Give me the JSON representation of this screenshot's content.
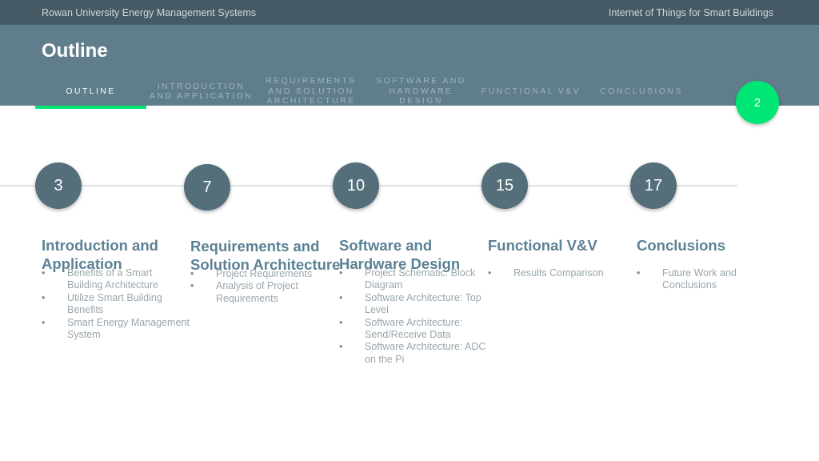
{
  "topbar": {
    "left_text": "Rowan University Energy Management Systems",
    "right_text": "Internet of Things for Smart Buildings"
  },
  "header": {
    "title": "Outline",
    "tabs": [
      {
        "label": "Outline",
        "active": true
      },
      {
        "label": "Introduction\nand Application",
        "active": false
      },
      {
        "label": "Requirements\nand Solution\nArchitecture",
        "active": false
      },
      {
        "label": "Software and\nHardware Design",
        "active": false
      },
      {
        "label": "Functional V&V",
        "active": false
      },
      {
        "label": "Conclusions",
        "active": false
      }
    ],
    "page_number": "2"
  },
  "timeline": {
    "nodes": [
      "3",
      "7",
      "10",
      "15",
      "17"
    ]
  },
  "sections": [
    {
      "title_lines": [
        "Introduction and",
        "Application"
      ],
      "items": [
        "Benefits of a Smart Building Architecture",
        "Utilize Smart Building Benefits",
        "Smart Energy Management System"
      ]
    },
    {
      "title_lines": [
        "Requirements and",
        "Solution Architecture"
      ],
      "items": [
        "Project Requirements",
        "Analysis of Project Requirements"
      ]
    },
    {
      "title_lines": [
        "Software and",
        "Hardware Design"
      ],
      "items": [
        "Project Schematic: Block Diagram",
        "Software Architecture: Top Level",
        "Software Architecture: Send/Receive Data",
        "Software Architecture: ADC on the Pi"
      ]
    },
    {
      "title_lines": [
        "Functional V&V"
      ],
      "items": [
        "Results Comparison"
      ]
    },
    {
      "title_lines": [
        "Conclusions"
      ],
      "items": [
        "Future Work and Conclusions"
      ]
    }
  ],
  "colors": {
    "topbar": "#455a64",
    "header": "#607d8b",
    "accent": "#00e676",
    "node": "#546e7a",
    "section_title": "#5c8196"
  }
}
